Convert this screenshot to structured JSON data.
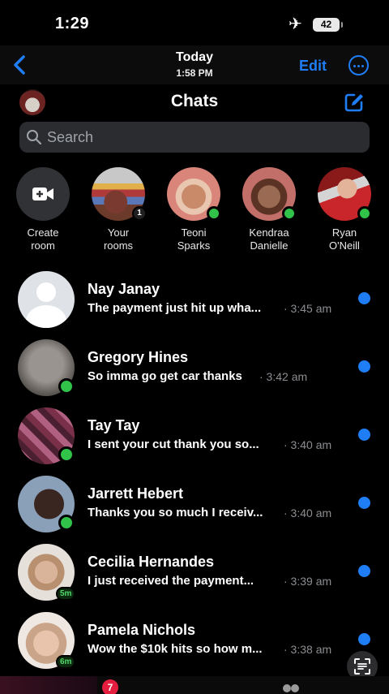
{
  "status_bar": {
    "time": "1:29",
    "battery": "42"
  },
  "nav": {
    "title": "Today",
    "subtitle": "1:58 PM",
    "edit_label": "Edit"
  },
  "header": {
    "title": "Chats"
  },
  "search": {
    "placeholder": "Search"
  },
  "stories": [
    {
      "line1": "Create",
      "line2": "room"
    },
    {
      "line1": "Your",
      "line2": "rooms",
      "count": "1"
    },
    {
      "line1": "Teoni",
      "line2": "Sparks"
    },
    {
      "line1": "Kendraa",
      "line2": "Danielle"
    },
    {
      "line1": "Ryan",
      "line2": "O'Neill"
    }
  ],
  "chats": [
    {
      "name": "Nay Janay",
      "preview": "The payment just hit up wha...",
      "time": "· 3:45 am"
    },
    {
      "name": "Gregory Hines",
      "preview": "So imma go get car thanks",
      "time": "· 3:42 am"
    },
    {
      "name": "Tay Tay",
      "preview": "I sent your cut thank you so...",
      "time": "· 3:40 am"
    },
    {
      "name": "Jarrett Hebert",
      "preview": "Thanks you so much I receiv...",
      "time": "· 3:40 am"
    },
    {
      "name": "Cecilia Hernandes",
      "preview": "I just received the payment...",
      "time": "· 3:39 am",
      "active_ago": "5m"
    },
    {
      "name": "Pamela Nichols",
      "preview": "Wow the $10k hits so how m...",
      "time": "· 3:38 am",
      "active_ago": "6m"
    }
  ],
  "bottom": {
    "chats_badge": "7"
  },
  "colors": {
    "accent": "#1f7ef5",
    "online": "#31c24a",
    "badge": "#e41e3f"
  }
}
